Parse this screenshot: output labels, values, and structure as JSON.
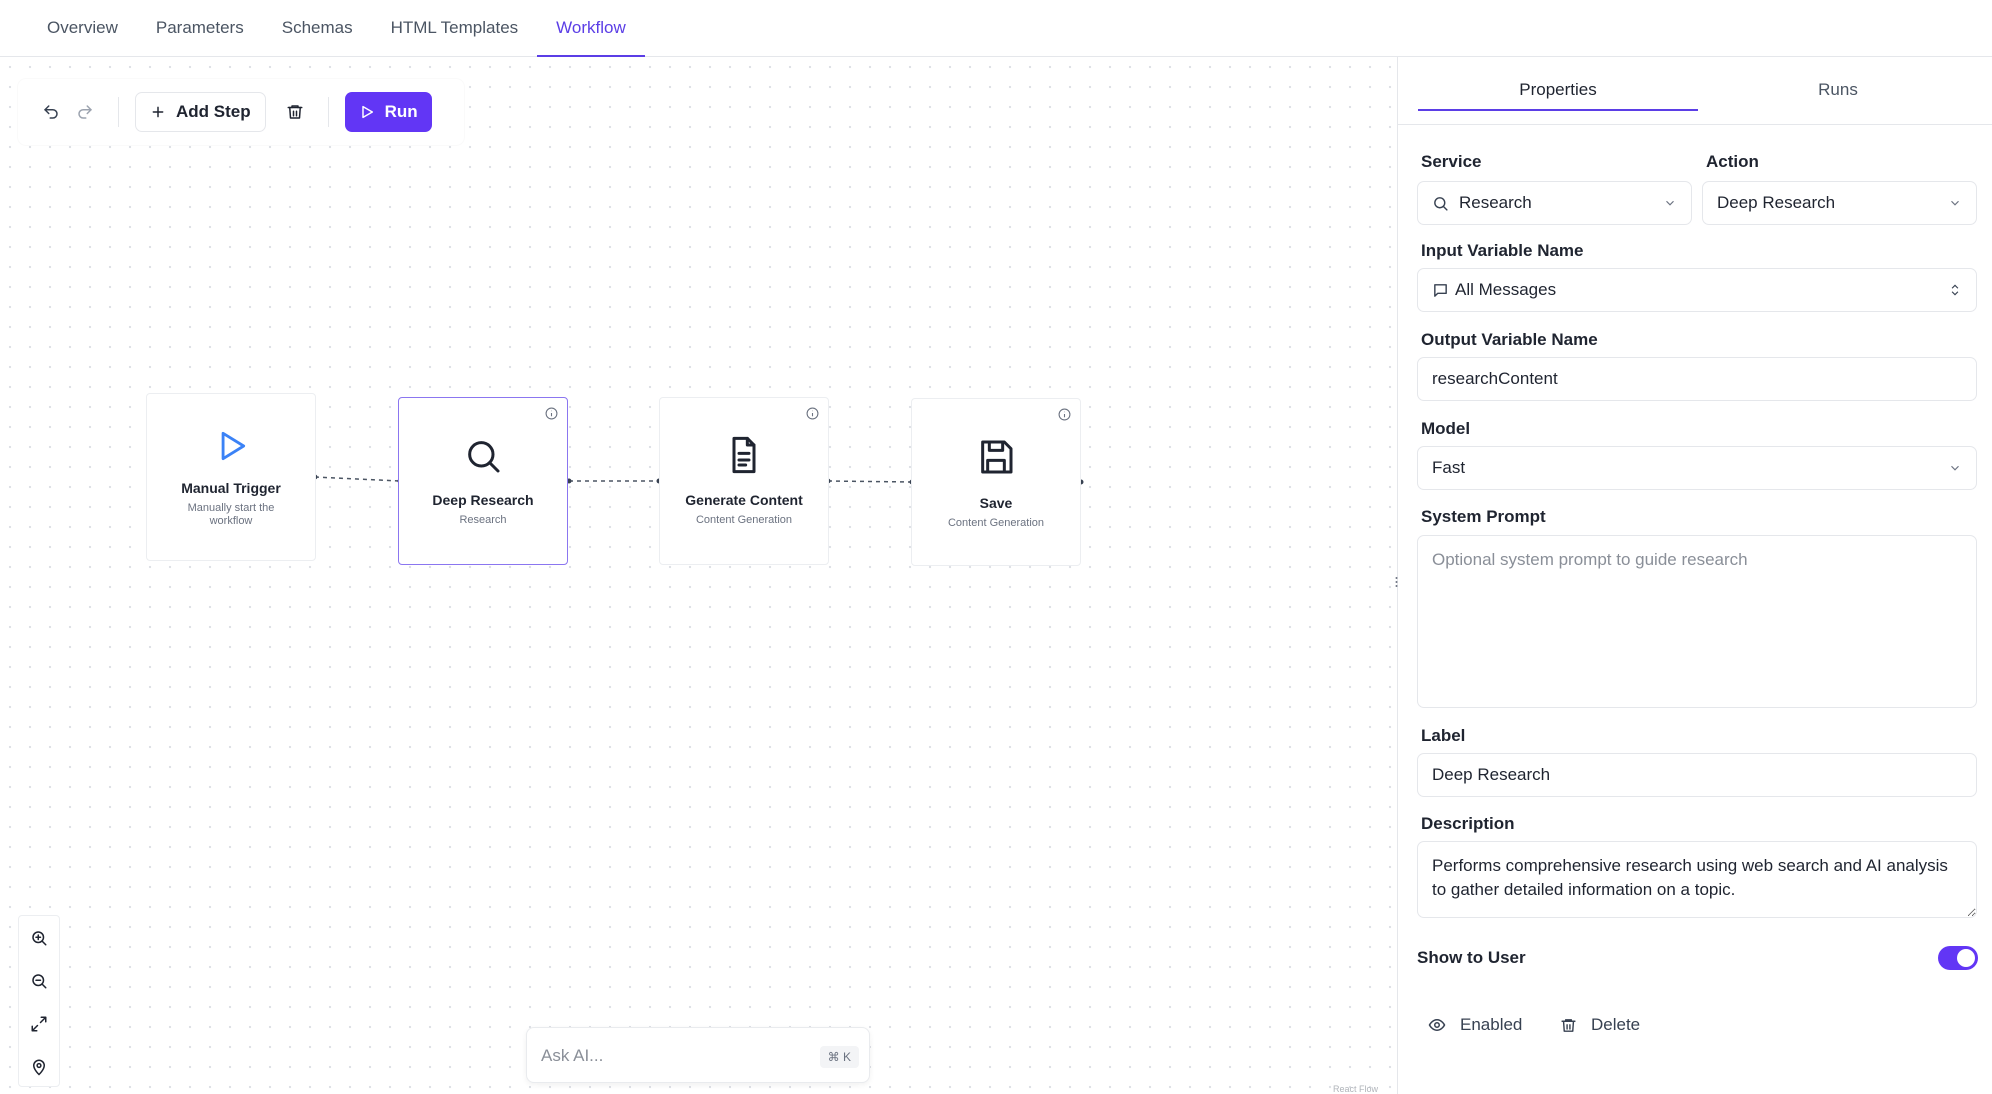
{
  "tabs": [
    {
      "label": "Overview"
    },
    {
      "label": "Parameters"
    },
    {
      "label": "Schemas"
    },
    {
      "label": "HTML Templates"
    },
    {
      "label": "Workflow"
    }
  ],
  "toolbar": {
    "add_step_label": "Add Step",
    "run_label": "Run"
  },
  "nodes": [
    {
      "title": "Manual Trigger",
      "subtitle": "Manually start the workflow",
      "icon": "play-icon"
    },
    {
      "title": "Deep Research",
      "subtitle": "Research",
      "icon": "search-icon"
    },
    {
      "title": "Generate Content",
      "subtitle": "Content Generation",
      "icon": "document-icon"
    },
    {
      "title": "Save",
      "subtitle": "Content Generation",
      "icon": "save-icon"
    }
  ],
  "ask_ai": {
    "placeholder": "Ask AI...",
    "shortcut": "⌘ K"
  },
  "canvas_attribution": "React Flow",
  "panel": {
    "tabs": [
      {
        "label": "Properties"
      },
      {
        "label": "Runs"
      }
    ],
    "service_label": "Service",
    "service_value": "Research",
    "action_label": "Action",
    "action_value": "Deep Research",
    "input_var_label": "Input Variable Name",
    "input_var_value": "All Messages",
    "output_var_label": "Output Variable Name",
    "output_var_value": "researchContent",
    "model_label": "Model",
    "model_value": "Fast",
    "system_prompt_label": "System Prompt",
    "system_prompt_placeholder": "Optional system prompt to guide research",
    "label_label": "Label",
    "label_value": "Deep Research",
    "description_label": "Description",
    "description_value": "Performs comprehensive research using web search and AI analysis to gather detailed information on a topic.",
    "show_to_user_label": "Show to User",
    "show_to_user": true,
    "enabled_label": "Enabled",
    "delete_label": "Delete"
  },
  "colors": {
    "accent": "#6236f5",
    "tab_active": "#5b3ee6",
    "trigger_icon": "#3b82f6"
  }
}
